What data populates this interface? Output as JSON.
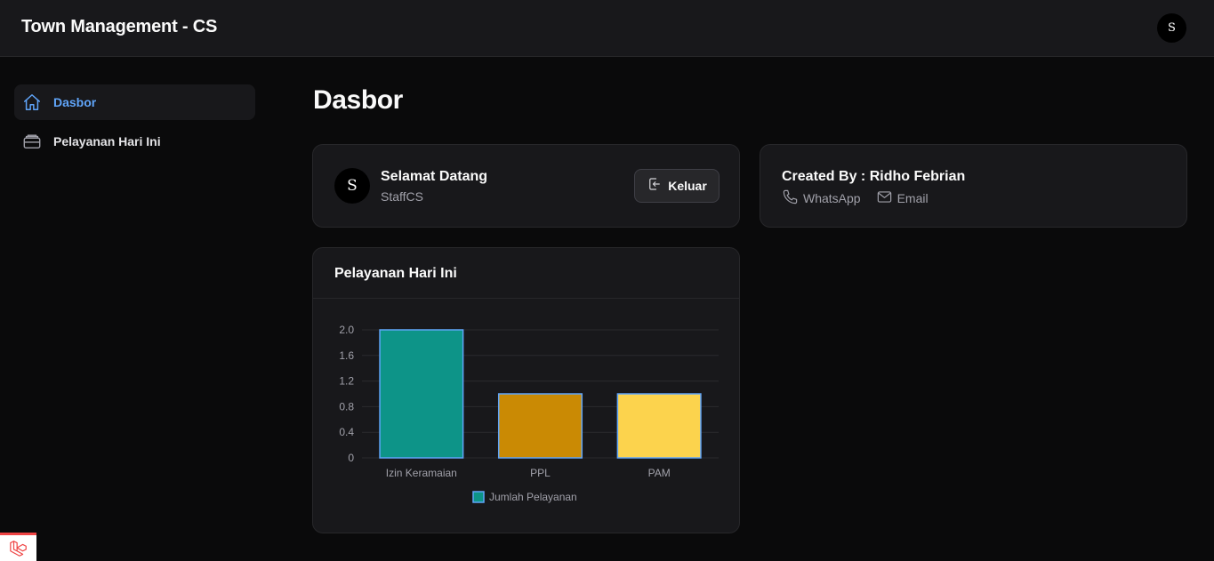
{
  "app": {
    "title": "Town Management - CS",
    "avatar_initial": "S"
  },
  "sidebar": {
    "items": [
      {
        "label": "Dasbor",
        "icon": "home-icon",
        "active": true
      },
      {
        "label": "Pelayanan Hari Ini",
        "icon": "inbox-icon",
        "active": false
      }
    ]
  },
  "page": {
    "title": "Dasbor"
  },
  "welcome": {
    "avatar_initial": "S",
    "greeting": "Selamat Datang",
    "role": "StaffCS",
    "logout_label": "Keluar"
  },
  "credit": {
    "title": "Created By : Ridho Febrian",
    "whatsapp_label": "WhatsApp",
    "email_label": "Email"
  },
  "chart": {
    "title": "Pelayanan Hari Ini"
  },
  "chart_data": {
    "type": "bar",
    "categories": [
      "Izin Keramaian",
      "PPL",
      "PAM"
    ],
    "series": [
      {
        "name": "Jumlah Pelayanan",
        "values": [
          2,
          1,
          1
        ]
      }
    ],
    "bar_colors": [
      "#0d9488",
      "#ca8a04",
      "#fcd34d"
    ],
    "bar_border": "#60a5fa",
    "ylim": [
      0,
      2
    ],
    "yticks": [
      "0",
      "0.4",
      "0.8",
      "1.2",
      "1.6",
      "2.0"
    ],
    "grid": true,
    "legend": "bottom"
  },
  "colors": {
    "accent": "#60a5fa",
    "background": "#0a0a0b",
    "card": "#18181b",
    "border": "#27272a"
  }
}
